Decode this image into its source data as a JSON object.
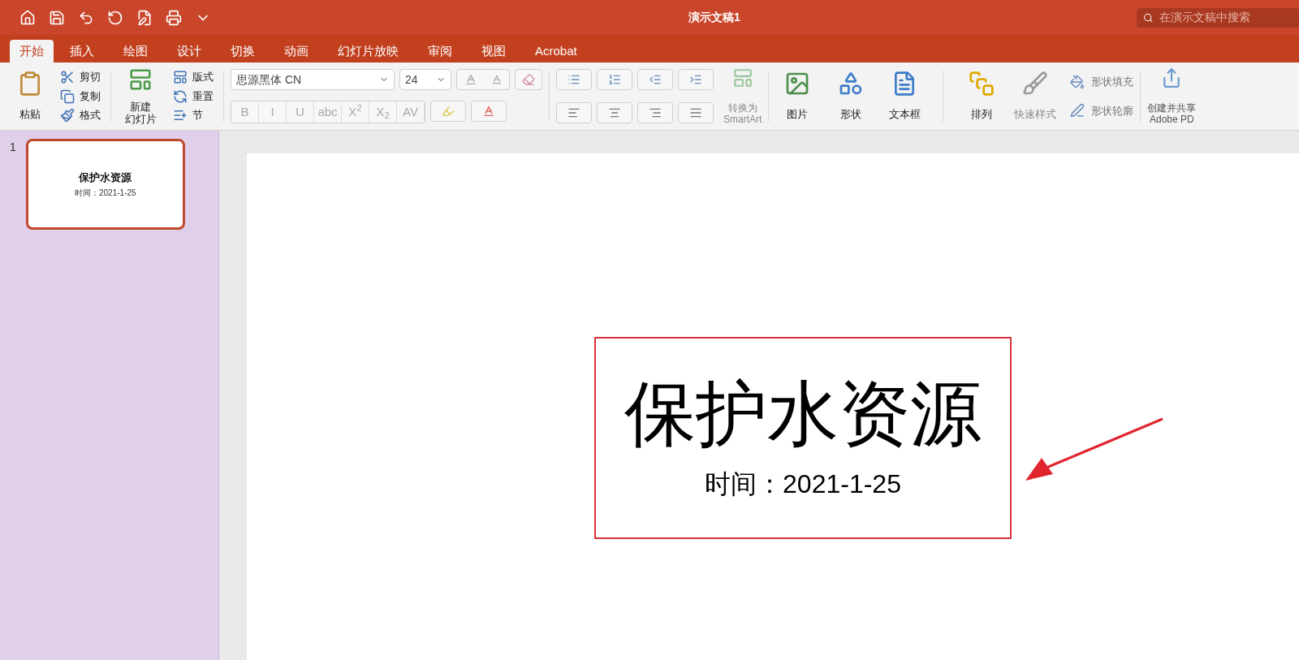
{
  "title_bar": {
    "title": "演示文稿1",
    "search": {
      "placeholder": "在演示文稿中搜索"
    }
  },
  "tabs": [
    {
      "label": "开始",
      "selected": true
    },
    {
      "label": "插入",
      "selected": false
    },
    {
      "label": "绘图",
      "selected": false
    },
    {
      "label": "设计",
      "selected": false
    },
    {
      "label": "切换",
      "selected": false
    },
    {
      "label": "动画",
      "selected": false
    },
    {
      "label": "幻灯片放映",
      "selected": false
    },
    {
      "label": "审阅",
      "selected": false
    },
    {
      "label": "视图",
      "selected": false
    },
    {
      "label": "Acrobat",
      "selected": false
    }
  ],
  "clipboard": {
    "paste": "粘贴",
    "small": [
      {
        "kind": "cut",
        "label": "剪切"
      },
      {
        "kind": "copy",
        "label": "复制"
      },
      {
        "kind": "format",
        "label": "格式"
      }
    ]
  },
  "slides_group": {
    "new_slide": [
      "新建",
      "幻灯片"
    ],
    "small": [
      {
        "kind": "layout",
        "label": "版式"
      },
      {
        "kind": "reset",
        "label": "重置"
      },
      {
        "kind": "section",
        "label": "节"
      }
    ]
  },
  "font": {
    "name": "思源黑体 CN",
    "size": "24",
    "format_buttons": [
      {
        "label": "B",
        "disabled": true
      },
      {
        "label": "I",
        "disabled": true
      },
      {
        "label": "U",
        "disabled": true
      },
      {
        "label": "abc",
        "disabled": true
      },
      {
        "label": "X$^{2}$",
        "disabled": true
      },
      {
        "label": "X$_{2}$",
        "disabled": true
      },
      {
        "label": "AV",
        "disabled": true
      }
    ]
  },
  "smartart": {
    "label": [
      "转换为",
      "SmartArt"
    ],
    "disabled": true
  },
  "insert_buttons": [
    {
      "kind": "picture",
      "label": "图片",
      "disabled": false
    },
    {
      "kind": "shape",
      "label": "形状",
      "disabled": false
    },
    {
      "kind": "textbox",
      "label": "文本框",
      "disabled": false
    },
    {
      "kind": "arrange",
      "label": "排列",
      "disabled": false
    },
    {
      "kind": "quickstyle",
      "label": "快速样式",
      "disabled": true
    }
  ],
  "shape_format": [
    {
      "kind": "fill",
      "label": "形状填充"
    },
    {
      "kind": "outline",
      "label": "形状轮廓"
    }
  ],
  "adobe": {
    "label": [
      "创建并共享",
      "Adobe PD"
    ]
  },
  "slide_panel": [
    {
      "number": "1",
      "title": "保护水资源",
      "subtitle": "时间：2021-1-25",
      "selected": true
    }
  ],
  "slide": {
    "title": "保护水资源",
    "subtitle": "时间：2021-1-25"
  }
}
